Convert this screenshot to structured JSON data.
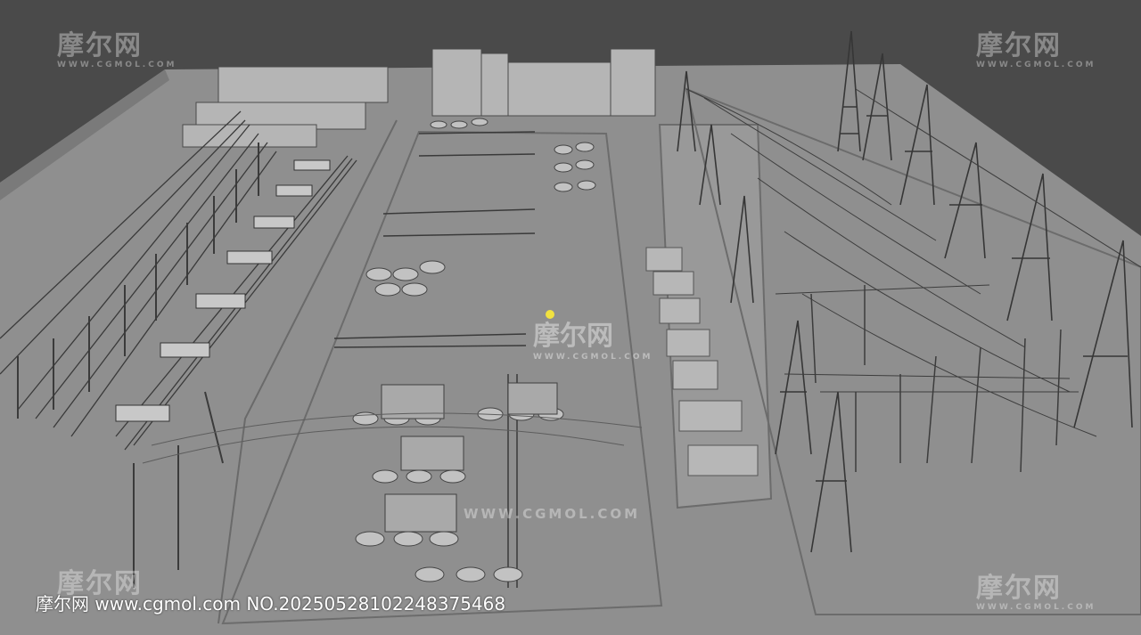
{
  "watermark": {
    "logo": "摩尔网",
    "logo_sub": "WWW.CGMOL.COM",
    "mid_url": "WWW.CGMOL.COM"
  },
  "footer": {
    "credit": "摩尔网 www.cgmol.com NO.20250528102248375468"
  },
  "colors": {
    "background": "#4a4a4a",
    "ground": "#8e8e8e",
    "structure": "#3a3a3a",
    "highlight": "#f2e240"
  }
}
